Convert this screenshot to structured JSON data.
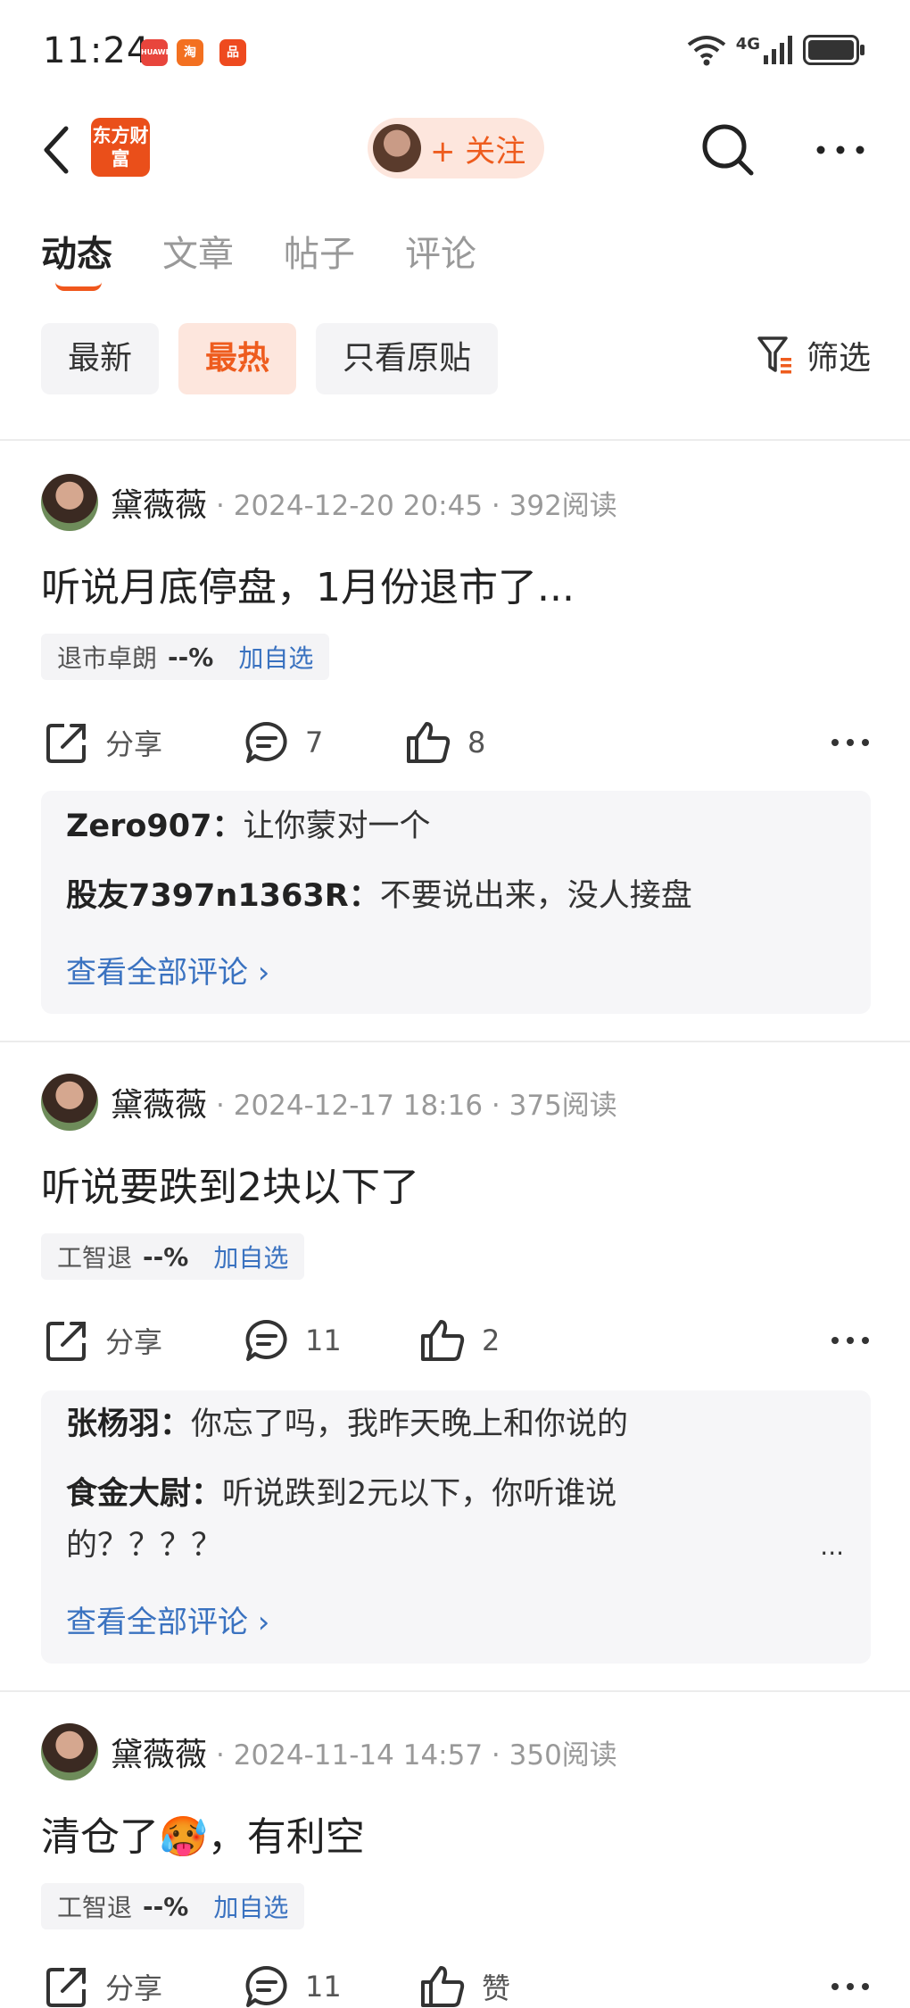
{
  "status_bar": {
    "time": "11:24",
    "network": "4G",
    "apps": [
      "HUAWEI",
      "淘",
      "品"
    ]
  },
  "header": {
    "logo_text": "东方财富",
    "follow_label": "+ 关注"
  },
  "tabs": [
    {
      "label": "动态",
      "active": true
    },
    {
      "label": "文章",
      "active": false
    },
    {
      "label": "帖子",
      "active": false
    },
    {
      "label": "评论",
      "active": false
    }
  ],
  "filters": [
    {
      "label": "最新",
      "active": false
    },
    {
      "label": "最热",
      "active": true
    },
    {
      "label": "只看原贴",
      "active": false
    }
  ],
  "filter_button": "筛选",
  "posts": [
    {
      "author": "黛薇薇",
      "meta": "· 2024-12-20 20:45 · 392阅读",
      "text": "听说月底停盘，1月份退市了...",
      "stock_name": "退市卓朗",
      "stock_change": "--%",
      "add_label": "加自选",
      "share_label": "分享",
      "comments": "7",
      "likes": "8",
      "comment_lines": [
        {
          "user": "Zero907：",
          "text": "让你蒙对一个"
        },
        {
          "user": "股友7397n1363R：",
          "text": "不要说出来，没人接盘"
        }
      ],
      "view_all": "查看全部评论 ›"
    },
    {
      "author": "黛薇薇",
      "meta": "· 2024-12-17 18:16 · 375阅读",
      "text": "听说要跌到2块以下了",
      "stock_name": "工智退",
      "stock_change": "--%",
      "add_label": "加自选",
      "share_label": "分享",
      "comments": "11",
      "likes": "2",
      "comment_lines": [
        {
          "user": "张杨羽：",
          "text": "你忘了吗，我昨天晚上和你说的"
        },
        {
          "user": "食金大尉：",
          "text": "听说跌到2元以下，你听谁说"
        },
        {
          "user": "",
          "text": "的？？？？"
        }
      ],
      "ellipsis": "...",
      "view_all": "查看全部评论 ›"
    },
    {
      "author": "黛薇薇",
      "meta": "· 2024-11-14 14:57 · 350阅读",
      "text": "清仓了🥵，有利空",
      "stock_name": "工智退",
      "stock_change": "--%",
      "add_label": "加自选",
      "share_label": "分享",
      "comments": "11",
      "likes": "赞"
    }
  ]
}
